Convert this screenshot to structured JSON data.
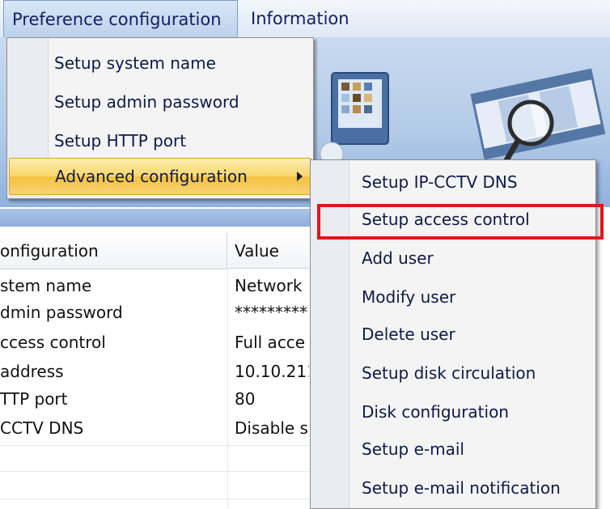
{
  "menubar": {
    "items": [
      {
        "label": "Preference configuration"
      },
      {
        "label": "Information"
      }
    ]
  },
  "dropdown": {
    "items": [
      {
        "label": "Setup system name"
      },
      {
        "label": "Setup admin password"
      },
      {
        "label": "Setup HTTP port"
      },
      {
        "label": "Advanced configuration",
        "highlighted": true,
        "has_submenu": true
      }
    ]
  },
  "submenu": {
    "items": [
      {
        "label": "Setup IP-CCTV DNS"
      },
      {
        "label": "Setup access control",
        "annotated": true
      },
      {
        "label": "Add user"
      },
      {
        "label": "Modify user"
      },
      {
        "label": "Delete user"
      },
      {
        "label": "Setup disk circulation"
      },
      {
        "label": "Disk configuration"
      },
      {
        "label": "Setup e-mail"
      },
      {
        "label": "Setup e-mail notification"
      }
    ]
  },
  "table": {
    "headers": {
      "config": "onfiguration",
      "value": "Value"
    },
    "rows": [
      {
        "name": "stem name",
        "value": "Network"
      },
      {
        "name": "dmin password",
        "value": "*********"
      },
      {
        "name": "ccess control",
        "value": "Full acce"
      },
      {
        "name": " address",
        "value": "10.10.211"
      },
      {
        "name": "TTP port",
        "value": "80"
      },
      {
        "name": " CCTV DNS",
        "value": "Disable s"
      }
    ]
  },
  "colors": {
    "highlight_box": "#e3161c",
    "menu_highlight": "#f9d66a",
    "banner": "#b3cbe8"
  },
  "icons": [
    "user-monitor-icon",
    "film-search-icon",
    "submenu-arrow-icon"
  ]
}
